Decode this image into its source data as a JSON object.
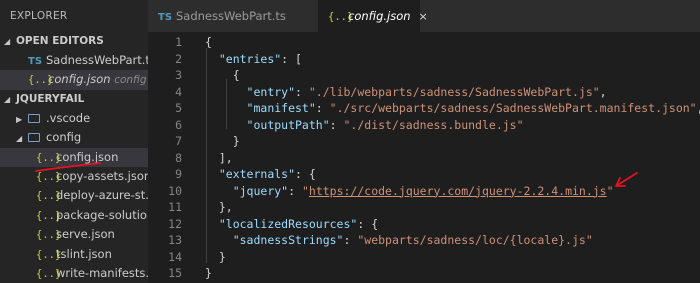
{
  "sidebar": {
    "title": "EXPLORER",
    "open_editors": {
      "label": "OPEN EDITORS",
      "items": [
        {
          "badge": "TS",
          "label": "SadnessWebPart.t..."
        },
        {
          "badge": "{..}",
          "label": "config.json",
          "hint": "config"
        }
      ]
    },
    "project": {
      "label": "JQUERYFAIL",
      "items": [
        {
          "label": ".vscode"
        },
        {
          "label": "config"
        },
        {
          "label": "config.json"
        },
        {
          "label": "copy-assets.json"
        },
        {
          "label": "deploy-azure-st..."
        },
        {
          "label": "package-solutio..."
        },
        {
          "label": "serve.json"
        },
        {
          "label": "tslint.json"
        },
        {
          "label": "write-manifests...."
        }
      ]
    }
  },
  "tabs": [
    {
      "badge": "TS",
      "label": "SadnessWebPart.ts"
    },
    {
      "badge": "{..}",
      "label": "config.json",
      "close": "×"
    }
  ],
  "editor": {
    "lines": [
      {
        "n": "1",
        "t": [
          [
            "p",
            "{"
          ]
        ]
      },
      {
        "n": "2",
        "t": [
          [
            "p",
            "  "
          ],
          [
            "k",
            "\"entries\""
          ],
          [
            "p",
            ": ["
          ]
        ]
      },
      {
        "n": "3",
        "t": [
          [
            "p",
            "    {"
          ]
        ]
      },
      {
        "n": "4",
        "t": [
          [
            "p",
            "      "
          ],
          [
            "k",
            "\"entry\""
          ],
          [
            "p",
            ": "
          ],
          [
            "s",
            "\"./lib/webparts/sadness/SadnessWebPart.js\""
          ],
          [
            "p",
            ","
          ]
        ]
      },
      {
        "n": "5",
        "t": [
          [
            "p",
            "      "
          ],
          [
            "k",
            "\"manifest\""
          ],
          [
            "p",
            ": "
          ],
          [
            "s",
            "\"./src/webparts/sadness/SadnessWebPart.manifest.json\""
          ],
          [
            "p",
            ","
          ]
        ]
      },
      {
        "n": "6",
        "t": [
          [
            "p",
            "      "
          ],
          [
            "k",
            "\"outputPath\""
          ],
          [
            "p",
            ": "
          ],
          [
            "s",
            "\"./dist/sadness.bundle.js\""
          ]
        ]
      },
      {
        "n": "7",
        "t": [
          [
            "p",
            "    }"
          ]
        ]
      },
      {
        "n": "8",
        "t": [
          [
            "p",
            "  ],"
          ]
        ]
      },
      {
        "n": "9",
        "t": [
          [
            "p",
            "  "
          ],
          [
            "k",
            "\"externals\""
          ],
          [
            "p",
            ": {"
          ]
        ]
      },
      {
        "n": "10",
        "t": [
          [
            "p",
            "    "
          ],
          [
            "k",
            "\"jquery\""
          ],
          [
            "p",
            ": "
          ],
          [
            "s",
            "\""
          ],
          [
            "u",
            "https://code.jquery.com/jquery-2.2.4.min.js"
          ],
          [
            "s",
            "\""
          ]
        ]
      },
      {
        "n": "11",
        "t": [
          [
            "p",
            "  },"
          ]
        ]
      },
      {
        "n": "12",
        "t": [
          [
            "p",
            "  "
          ],
          [
            "k",
            "\"localizedResources\""
          ],
          [
            "p",
            ": {"
          ]
        ]
      },
      {
        "n": "13",
        "t": [
          [
            "p",
            "    "
          ],
          [
            "k",
            "\"sadnessStrings\""
          ],
          [
            "p",
            ": "
          ],
          [
            "s",
            "\"webparts/sadness/loc/{locale}.js\""
          ]
        ]
      },
      {
        "n": "14",
        "t": [
          [
            "p",
            "  }"
          ]
        ]
      },
      {
        "n": "15",
        "t": [
          [
            "p",
            "}"
          ]
        ]
      }
    ]
  },
  "colors": {
    "annotation": "#e81123",
    "key": "#9cdcfe",
    "string": "#ce9178",
    "json_icon": "#cbcb41",
    "ts_icon": "#519aba"
  }
}
